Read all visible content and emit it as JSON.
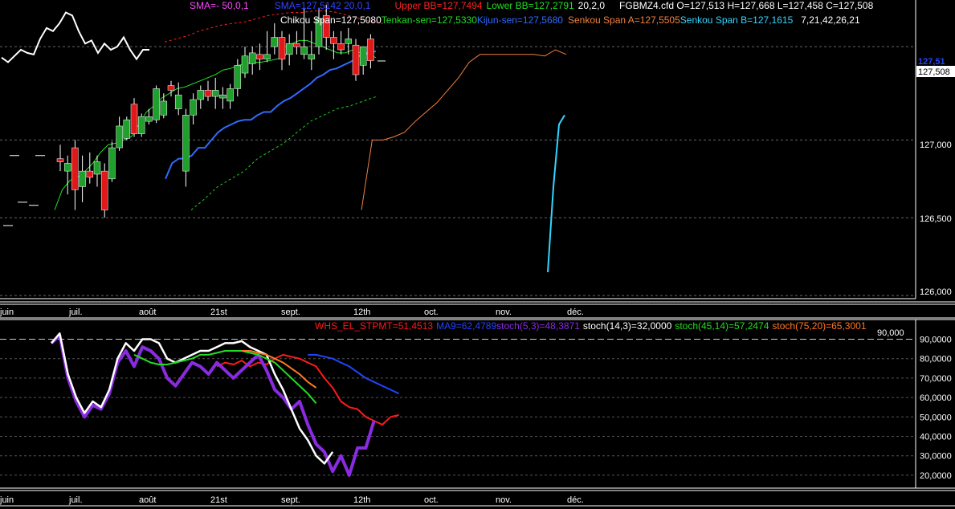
{
  "colors": {
    "background": "#000000",
    "candle_up": "#1fa02c",
    "candle_down": "#e01818",
    "chikou": "#ffffff",
    "tenkan": "#22dd22",
    "kijun": "#2f6bff",
    "senkou_a": "#f08040",
    "senkou_b": "#33d6ff",
    "upper_bb": "#ff2020",
    "lower_bb": "#22cc22",
    "bb_mid": "#a020f0",
    "sma_magenta": "#ff44ff",
    "whs": "#ff1a1a",
    "ma9": "#2244ff",
    "stoch53": "#8a2be2",
    "stoch143": "#ffffff",
    "stoch4514": "#22dd22",
    "stoch7520": "#ff7722"
  },
  "header": {
    "line1": [
      {
        "text": "SMA=-  50,0,1",
        "color": "#ff44ff"
      },
      {
        "text": "SMA=127,5142  20,0,1",
        "color": "#3344ff"
      },
      {
        "text": "Upper BB=127,7494",
        "color": "#ff2020"
      },
      {
        "text": "Lower BB=127,2791",
        "color": "#22dd22"
      },
      {
        "text": "20,2,0",
        "color": "#ffffff"
      },
      {
        "text": "FGBMZ4.cfd O=127,513 H=127,668 L=127,458 C=127,508",
        "color": "#ffffff"
      }
    ],
    "line2": [
      {
        "text": "Chikou Span=127,5080",
        "color": "#ffffff"
      },
      {
        "text": "Tenkan-sen=127,5330",
        "color": "#22dd22"
      },
      {
        "text": "Kijun-sen=127,5680",
        "color": "#2f6bff"
      },
      {
        "text": "Senkou Span A=127,5505",
        "color": "#f08040"
      },
      {
        "text": "Senkou Span B=127,1615",
        "color": "#33d6ff"
      },
      {
        "text": "7,21,42,26,21",
        "color": "#ffffff"
      }
    ]
  },
  "lower_header": [
    {
      "text": "WHS_EL_STPMT=51,4513",
      "color": "#ff1a1a"
    },
    {
      "text": "MA9=62,4789",
      "color": "#2244ff"
    },
    {
      "text": "stoch(5,3)=48,3871",
      "color": "#8a2be2"
    },
    {
      "text": "stoch(14,3)=32,0000",
      "color": "#ffffff"
    },
    {
      "text": "stoch(45,14)=57,2474",
      "color": "#22dd22"
    },
    {
      "text": "stoch(75,20)=65,3001",
      "color": "#ff7722"
    }
  ],
  "price_axis": {
    "ticks": [
      "127,000",
      "126,500",
      "126,000"
    ],
    "last_price": "127,508",
    "prev_label": "127,51"
  },
  "osc_axis": {
    "ticks": [
      "90,0000",
      "80,0000",
      "70,0000",
      "60,0000",
      "50,0000",
      "40,0000",
      "30,0000",
      "20,0000"
    ],
    "level_label": "90,000"
  },
  "date_axis": [
    "juin",
    "juil.",
    "août",
    "21st",
    "sept.",
    "12th",
    "oct.",
    "nov.",
    "déc."
  ],
  "chart_data": [
    {
      "type": "candlestick",
      "title": "FGBMZ4.cfd",
      "ylim": [
        125.98,
        127.9
      ],
      "candles": [
        {
          "o": 126.88,
          "h": 126.97,
          "l": 126.8,
          "c": 126.86
        },
        {
          "o": 126.8,
          "h": 126.9,
          "l": 126.65,
          "c": 126.85
        },
        {
          "o": 126.95,
          "h": 127.0,
          "l": 126.55,
          "c": 126.68
        },
        {
          "o": 126.7,
          "h": 126.9,
          "l": 126.6,
          "c": 126.8
        },
        {
          "o": 126.8,
          "h": 126.92,
          "l": 126.72,
          "c": 126.76
        },
        {
          "o": 126.78,
          "h": 126.9,
          "l": 126.7,
          "c": 126.86
        },
        {
          "o": 126.8,
          "h": 126.85,
          "l": 126.5,
          "c": 126.55
        },
        {
          "o": 126.75,
          "h": 126.99,
          "l": 126.73,
          "c": 126.95
        },
        {
          "o": 126.95,
          "h": 127.15,
          "l": 126.93,
          "c": 127.09
        },
        {
          "o": 127.01,
          "h": 127.15,
          "l": 127.0,
          "c": 127.13
        },
        {
          "o": 127.23,
          "h": 127.27,
          "l": 127.02,
          "c": 127.04
        },
        {
          "o": 127.04,
          "h": 127.17,
          "l": 127.02,
          "c": 127.15
        },
        {
          "o": 127.12,
          "h": 127.2,
          "l": 127.1,
          "c": 127.15
        },
        {
          "o": 127.13,
          "h": 127.35,
          "l": 127.11,
          "c": 127.33
        },
        {
          "o": 127.16,
          "h": 127.3,
          "l": 127.14,
          "c": 127.25
        },
        {
          "o": 127.35,
          "h": 127.38,
          "l": 127.28,
          "c": 127.32
        },
        {
          "o": 127.2,
          "h": 127.37,
          "l": 127.16,
          "c": 127.29
        },
        {
          "o": 126.8,
          "h": 127.2,
          "l": 126.7,
          "c": 127.16
        },
        {
          "o": 127.16,
          "h": 127.3,
          "l": 127.1,
          "c": 127.26
        },
        {
          "o": 127.26,
          "h": 127.35,
          "l": 127.2,
          "c": 127.32
        },
        {
          "o": 127.32,
          "h": 127.38,
          "l": 127.25,
          "c": 127.28
        },
        {
          "o": 127.28,
          "h": 127.4,
          "l": 127.2,
          "c": 127.32
        },
        {
          "o": 127.27,
          "h": 127.34,
          "l": 127.2,
          "c": 127.29
        },
        {
          "o": 127.25,
          "h": 127.36,
          "l": 127.2,
          "c": 127.33
        },
        {
          "o": 127.33,
          "h": 127.52,
          "l": 127.28,
          "c": 127.48
        },
        {
          "o": 127.43,
          "h": 127.6,
          "l": 127.4,
          "c": 127.54
        },
        {
          "o": 127.49,
          "h": 127.6,
          "l": 127.42,
          "c": 127.56
        },
        {
          "o": 127.55,
          "h": 127.62,
          "l": 127.45,
          "c": 127.52
        },
        {
          "o": 127.52,
          "h": 127.7,
          "l": 127.5,
          "c": 127.55
        },
        {
          "o": 127.6,
          "h": 127.75,
          "l": 127.55,
          "c": 127.66
        },
        {
          "o": 127.66,
          "h": 127.7,
          "l": 127.45,
          "c": 127.52
        },
        {
          "o": 127.55,
          "h": 127.68,
          "l": 127.48,
          "c": 127.62
        },
        {
          "o": 127.62,
          "h": 127.7,
          "l": 127.55,
          "c": 127.6
        },
        {
          "o": 127.55,
          "h": 127.85,
          "l": 127.52,
          "c": 127.6
        },
        {
          "o": 127.52,
          "h": 127.7,
          "l": 127.45,
          "c": 127.55
        },
        {
          "o": 127.6,
          "h": 127.85,
          "l": 127.55,
          "c": 127.78
        },
        {
          "o": 127.8,
          "h": 127.87,
          "l": 127.58,
          "c": 127.66
        },
        {
          "o": 127.66,
          "h": 127.7,
          "l": 127.52,
          "c": 127.62
        },
        {
          "o": 127.62,
          "h": 127.7,
          "l": 127.55,
          "c": 127.58
        },
        {
          "o": 127.62,
          "h": 127.72,
          "l": 127.55,
          "c": 127.65
        },
        {
          "o": 127.61,
          "h": 127.65,
          "l": 127.38,
          "c": 127.42
        },
        {
          "o": 127.48,
          "h": 127.6,
          "l": 127.42,
          "c": 127.6
        },
        {
          "o": 127.65,
          "h": 127.68,
          "l": 127.46,
          "c": 127.51
        }
      ],
      "chikou": [
        127.53,
        127.5,
        127.54,
        127.58,
        127.56,
        127.55,
        127.65,
        127.72,
        127.7,
        127.75,
        127.82,
        127.8,
        127.7,
        127.62,
        127.64,
        127.56,
        127.62,
        127.58,
        127.6,
        127.66,
        127.58,
        127.52,
        127.58,
        127.58
      ],
      "tenkan": [
        126.55,
        126.68,
        126.74,
        126.76,
        126.8,
        126.85,
        126.92,
        126.97,
        126.98,
        127.0,
        127.02,
        127.1,
        127.18,
        127.22,
        127.27,
        127.3,
        127.33,
        127.34,
        127.36,
        127.38,
        127.4,
        127.42,
        127.45,
        127.46,
        127.48,
        127.49,
        127.5,
        127.5,
        127.51,
        127.52,
        127.53,
        127.62,
        127.64,
        127.64,
        127.62,
        127.6,
        127.58,
        127.56,
        127.56,
        127.58,
        127.56,
        127.55,
        127.53
      ],
      "kijun": [
        126.75,
        126.85,
        126.88,
        126.88,
        126.9,
        126.95,
        126.95,
        127.0,
        127.05,
        127.08,
        127.1,
        127.12,
        127.13,
        127.13,
        127.16,
        127.18,
        127.18,
        127.22,
        127.25,
        127.27,
        127.3,
        127.33,
        127.36,
        127.4,
        127.42,
        127.45,
        127.46,
        127.48,
        127.5,
        127.52,
        127.56,
        127.56,
        127.57
      ],
      "senkou_a": [
        126.55,
        127.0,
        127.0,
        127.02,
        127.05,
        127.12,
        127.18,
        127.24,
        127.32,
        127.4,
        127.5,
        127.55,
        127.55,
        127.55,
        127.55,
        127.55,
        127.55,
        127.54,
        127.58,
        127.55
      ],
      "senkou_b": [
        126.15,
        126.7,
        127.1,
        127.16
      ],
      "upper_bb": [
        127.63,
        127.65,
        127.67,
        127.7,
        127.72,
        127.74,
        127.75,
        127.76,
        127.78,
        127.8,
        127.81,
        127.82,
        127.82,
        127.83,
        127.83,
        127.82,
        127.8,
        127.78,
        127.76,
        127.75
      ],
      "lower_bb": [
        126.55,
        126.62,
        126.7,
        126.75,
        126.8,
        126.88,
        126.93,
        126.98,
        127.05,
        127.12,
        127.16,
        127.2,
        127.22,
        127.25,
        127.28
      ],
      "price_markers": [
        126.9,
        126.9,
        126.6,
        126.58,
        126.45
      ]
    },
    {
      "type": "line",
      "title": "",
      "ylim": [
        15,
        96
      ],
      "level": 90,
      "series": [
        {
          "name": "WHS_EL_STPMT",
          "color": "#ff1a1a",
          "values": [
            null,
            null,
            null,
            null,
            null,
            null,
            null,
            null,
            null,
            null,
            null,
            null,
            null,
            null,
            null,
            null,
            null,
            null,
            null,
            null,
            76,
            78,
            77,
            79,
            76,
            78,
            77,
            80,
            82,
            81,
            80,
            78,
            76,
            70,
            65,
            58,
            55,
            54,
            50,
            48,
            46,
            50,
            51
          ]
        },
        {
          "name": "MA9",
          "color": "#2244ff",
          "values": [
            null,
            null,
            null,
            null,
            null,
            null,
            null,
            null,
            null,
            null,
            null,
            null,
            null,
            null,
            null,
            null,
            null,
            null,
            null,
            null,
            null,
            null,
            null,
            null,
            null,
            null,
            null,
            null,
            null,
            null,
            null,
            82,
            82,
            81,
            80,
            78,
            76,
            73,
            70,
            68,
            66,
            64,
            62
          ]
        },
        {
          "name": "stoch(5,3)",
          "color": "#8a2be2",
          "values": [
            88,
            92,
            70,
            58,
            50,
            56,
            54,
            62,
            78,
            84,
            76,
            86,
            84,
            80,
            70,
            66,
            72,
            78,
            76,
            72,
            78,
            74,
            70,
            74,
            78,
            82,
            74,
            64,
            60,
            54,
            58,
            46,
            36,
            32,
            22,
            30,
            20,
            34,
            34,
            48
          ]
        },
        {
          "name": "stoch(14,3)",
          "color": "#ffffff",
          "values": [
            88,
            93,
            72,
            60,
            52,
            58,
            55,
            64,
            80,
            88,
            84,
            90,
            90,
            88,
            80,
            78,
            80,
            82,
            84,
            84,
            86,
            88,
            88,
            89,
            86,
            84,
            82,
            72,
            64,
            54,
            44,
            38,
            30,
            26,
            32
          ]
        },
        {
          "name": "stoch(45,14)",
          "color": "#22dd22",
          "values": [
            null,
            null,
            null,
            null,
            null,
            null,
            null,
            null,
            null,
            null,
            82,
            80,
            78,
            77,
            77,
            78,
            79,
            80,
            82,
            82,
            83,
            84,
            84,
            84,
            83,
            82,
            80,
            78,
            74,
            70,
            66,
            62,
            57
          ]
        },
        {
          "name": "stoch(75,20)",
          "color": "#ff7722",
          "values": [
            null,
            null,
            null,
            null,
            null,
            null,
            null,
            null,
            null,
            null,
            null,
            null,
            null,
            null,
            null,
            null,
            null,
            null,
            null,
            null,
            null,
            null,
            null,
            84,
            84,
            83,
            82,
            80,
            78,
            75,
            72,
            68,
            65
          ]
        }
      ]
    }
  ]
}
